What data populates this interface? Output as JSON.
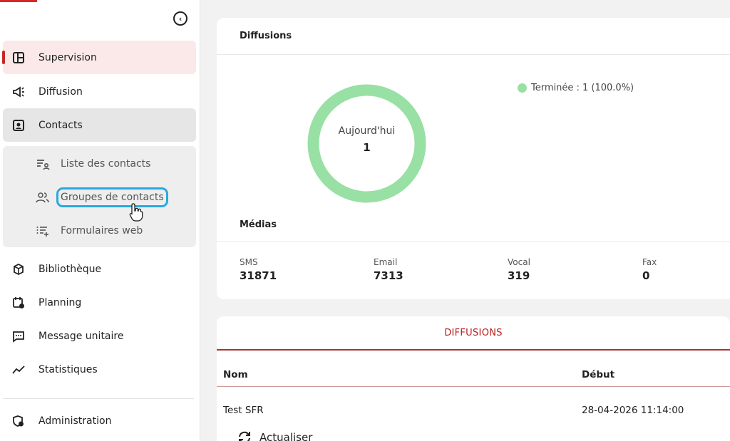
{
  "sidebar": {
    "collapse_icon": "chevron-left-circle-icon",
    "items": {
      "supervision": {
        "label": "Supervision",
        "icon": "dashboard-icon"
      },
      "diffusion": {
        "label": "Diffusion",
        "icon": "megaphone-icon"
      },
      "contacts": {
        "label": "Contacts",
        "icon": "contact-card-icon"
      },
      "bibliotheque": {
        "label": "Bibliothèque",
        "icon": "package-icon"
      },
      "planning": {
        "label": "Planning",
        "icon": "calendar-clock-icon"
      },
      "message_unitaire": {
        "label": "Message unitaire",
        "icon": "chat-icon"
      },
      "statistiques": {
        "label": "Statistiques",
        "icon": "trend-icon"
      },
      "administration": {
        "label": "Administration",
        "icon": "shield-gear-icon"
      }
    },
    "contacts_submenu": {
      "liste": {
        "label": "Liste des contacts",
        "icon": "list-person-icon"
      },
      "groupes": {
        "label": "Groupes de contacts",
        "icon": "group-icon"
      },
      "formulaires": {
        "label": "Formulaires web",
        "icon": "list-add-icon"
      }
    }
  },
  "diffusions_card": {
    "title": "Diffusions",
    "donut_label": "Aujourd'hui",
    "donut_value": "1",
    "legend": "Terminée : 1 (100.0%)",
    "legend_color": "#98e0a3",
    "completed_fraction": 1.0
  },
  "medias": {
    "title": "Médias",
    "items": {
      "sms": {
        "label": "SMS",
        "value": "31871"
      },
      "email": {
        "label": "Email",
        "value": "7313"
      },
      "vocal": {
        "label": "Vocal",
        "value": "319"
      },
      "fax": {
        "label": "Fax",
        "value": "0"
      }
    }
  },
  "diffusions_table": {
    "tab_label": "DIFFUSIONS",
    "columns": {
      "nom": "Nom",
      "debut": "Début"
    },
    "rows": [
      {
        "nom": "Test SFR",
        "debut": "28-04-2026 11:14:00"
      }
    ],
    "refresh_label": "Actualiser"
  },
  "colors": {
    "accent": "#c62828",
    "active_bg": "#fbe9e9",
    "donut": "#98e0a3",
    "highlight": "#2aa8e0"
  }
}
